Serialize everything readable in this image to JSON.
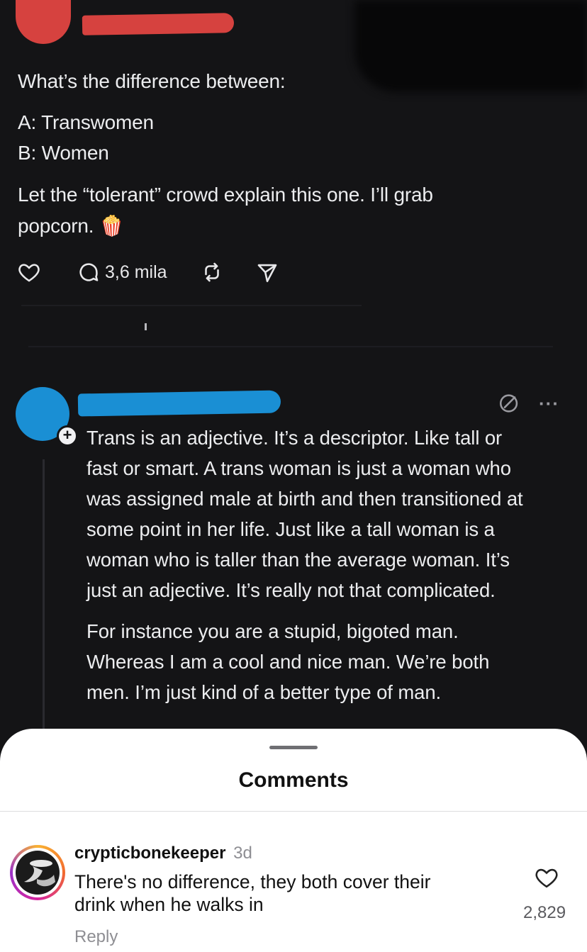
{
  "post": {
    "lines": [
      "What’s the difference between:",
      "A: Transwomen",
      "B: Women",
      "Let the “tolerant” crowd explain this one. I’ll grab",
      "popcorn. 🍿"
    ],
    "reply_count": "3,6 mila"
  },
  "reply": {
    "paragraph1": [
      "Trans is an adjective. It’s a descriptor. Like tall or",
      "fast or smart. A trans woman is just a woman who",
      "was assigned male at birth and then transitioned at",
      "some point in her life. Just like a tall woman is a",
      "woman who is taller than the average woman. It’s",
      "just an adjective. It’s really not that complicated."
    ],
    "paragraph2": [
      "For instance you are a stupid, bigoted man.",
      "Whereas I am a cool and nice man. We’re both",
      "men. I’m just kind of a better type of man."
    ],
    "plus_badge": "+",
    "more_label": "···"
  },
  "comments_sheet": {
    "title": "Comments",
    "comment": {
      "username": "crypticbonekeeper",
      "time": "3d",
      "text_lines": [
        "There's no difference, they both cover their",
        "drink when he walks in"
      ],
      "reply_label": "Reply",
      "likes": "2,829"
    }
  },
  "colors": {
    "background": "#141416",
    "redaction_red": "#d6423f",
    "redaction_blue": "#1a8fd4",
    "sheet": "#ffffff"
  },
  "icons": [
    "heart-icon",
    "comment-icon",
    "repost-icon",
    "share-icon",
    "translate-icon",
    "more-icon",
    "comment-like-heart-icon"
  ]
}
